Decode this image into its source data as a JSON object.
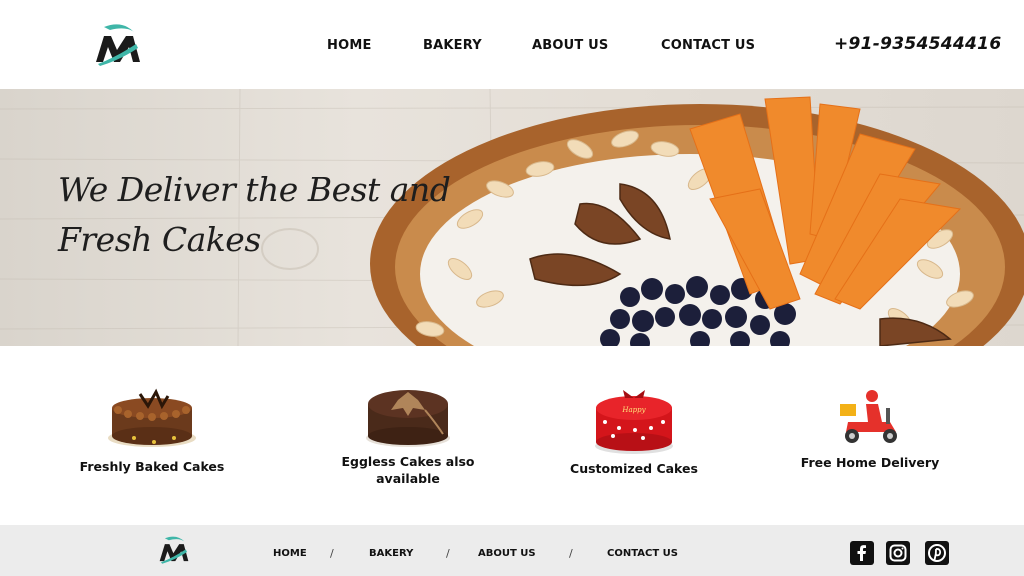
{
  "header": {
    "logo_name": "m-logo",
    "nav": [
      {
        "label": "HOME"
      },
      {
        "label": "BAKERY"
      },
      {
        "label": "ABOUT US"
      },
      {
        "label": "CONTACT US"
      }
    ],
    "phone": "+91-9354544416"
  },
  "hero": {
    "title": "We Deliver the Best and Fresh Cakes"
  },
  "features": [
    {
      "label": "Freshly Baked Cakes",
      "icon": "chocolate-cake-icon"
    },
    {
      "label": "Eggless Cakes also available",
      "icon": "eggless-cake-icon"
    },
    {
      "label": "Customized Cakes",
      "icon": "birthday-cake-icon"
    },
    {
      "label": "Free Home Delivery",
      "icon": "delivery-scooter-icon"
    }
  ],
  "footer": {
    "nav": [
      {
        "label": "HOME"
      },
      {
        "label": "BAKERY"
      },
      {
        "label": "ABOUT US"
      },
      {
        "label": "CONTACT US"
      }
    ],
    "separator": "/",
    "social": [
      "facebook-icon",
      "instagram-icon",
      "pinterest-icon"
    ]
  },
  "colors": {
    "accent_teal": "#3fb6a8",
    "text_dark": "#111111",
    "footer_bg": "#ececec"
  }
}
